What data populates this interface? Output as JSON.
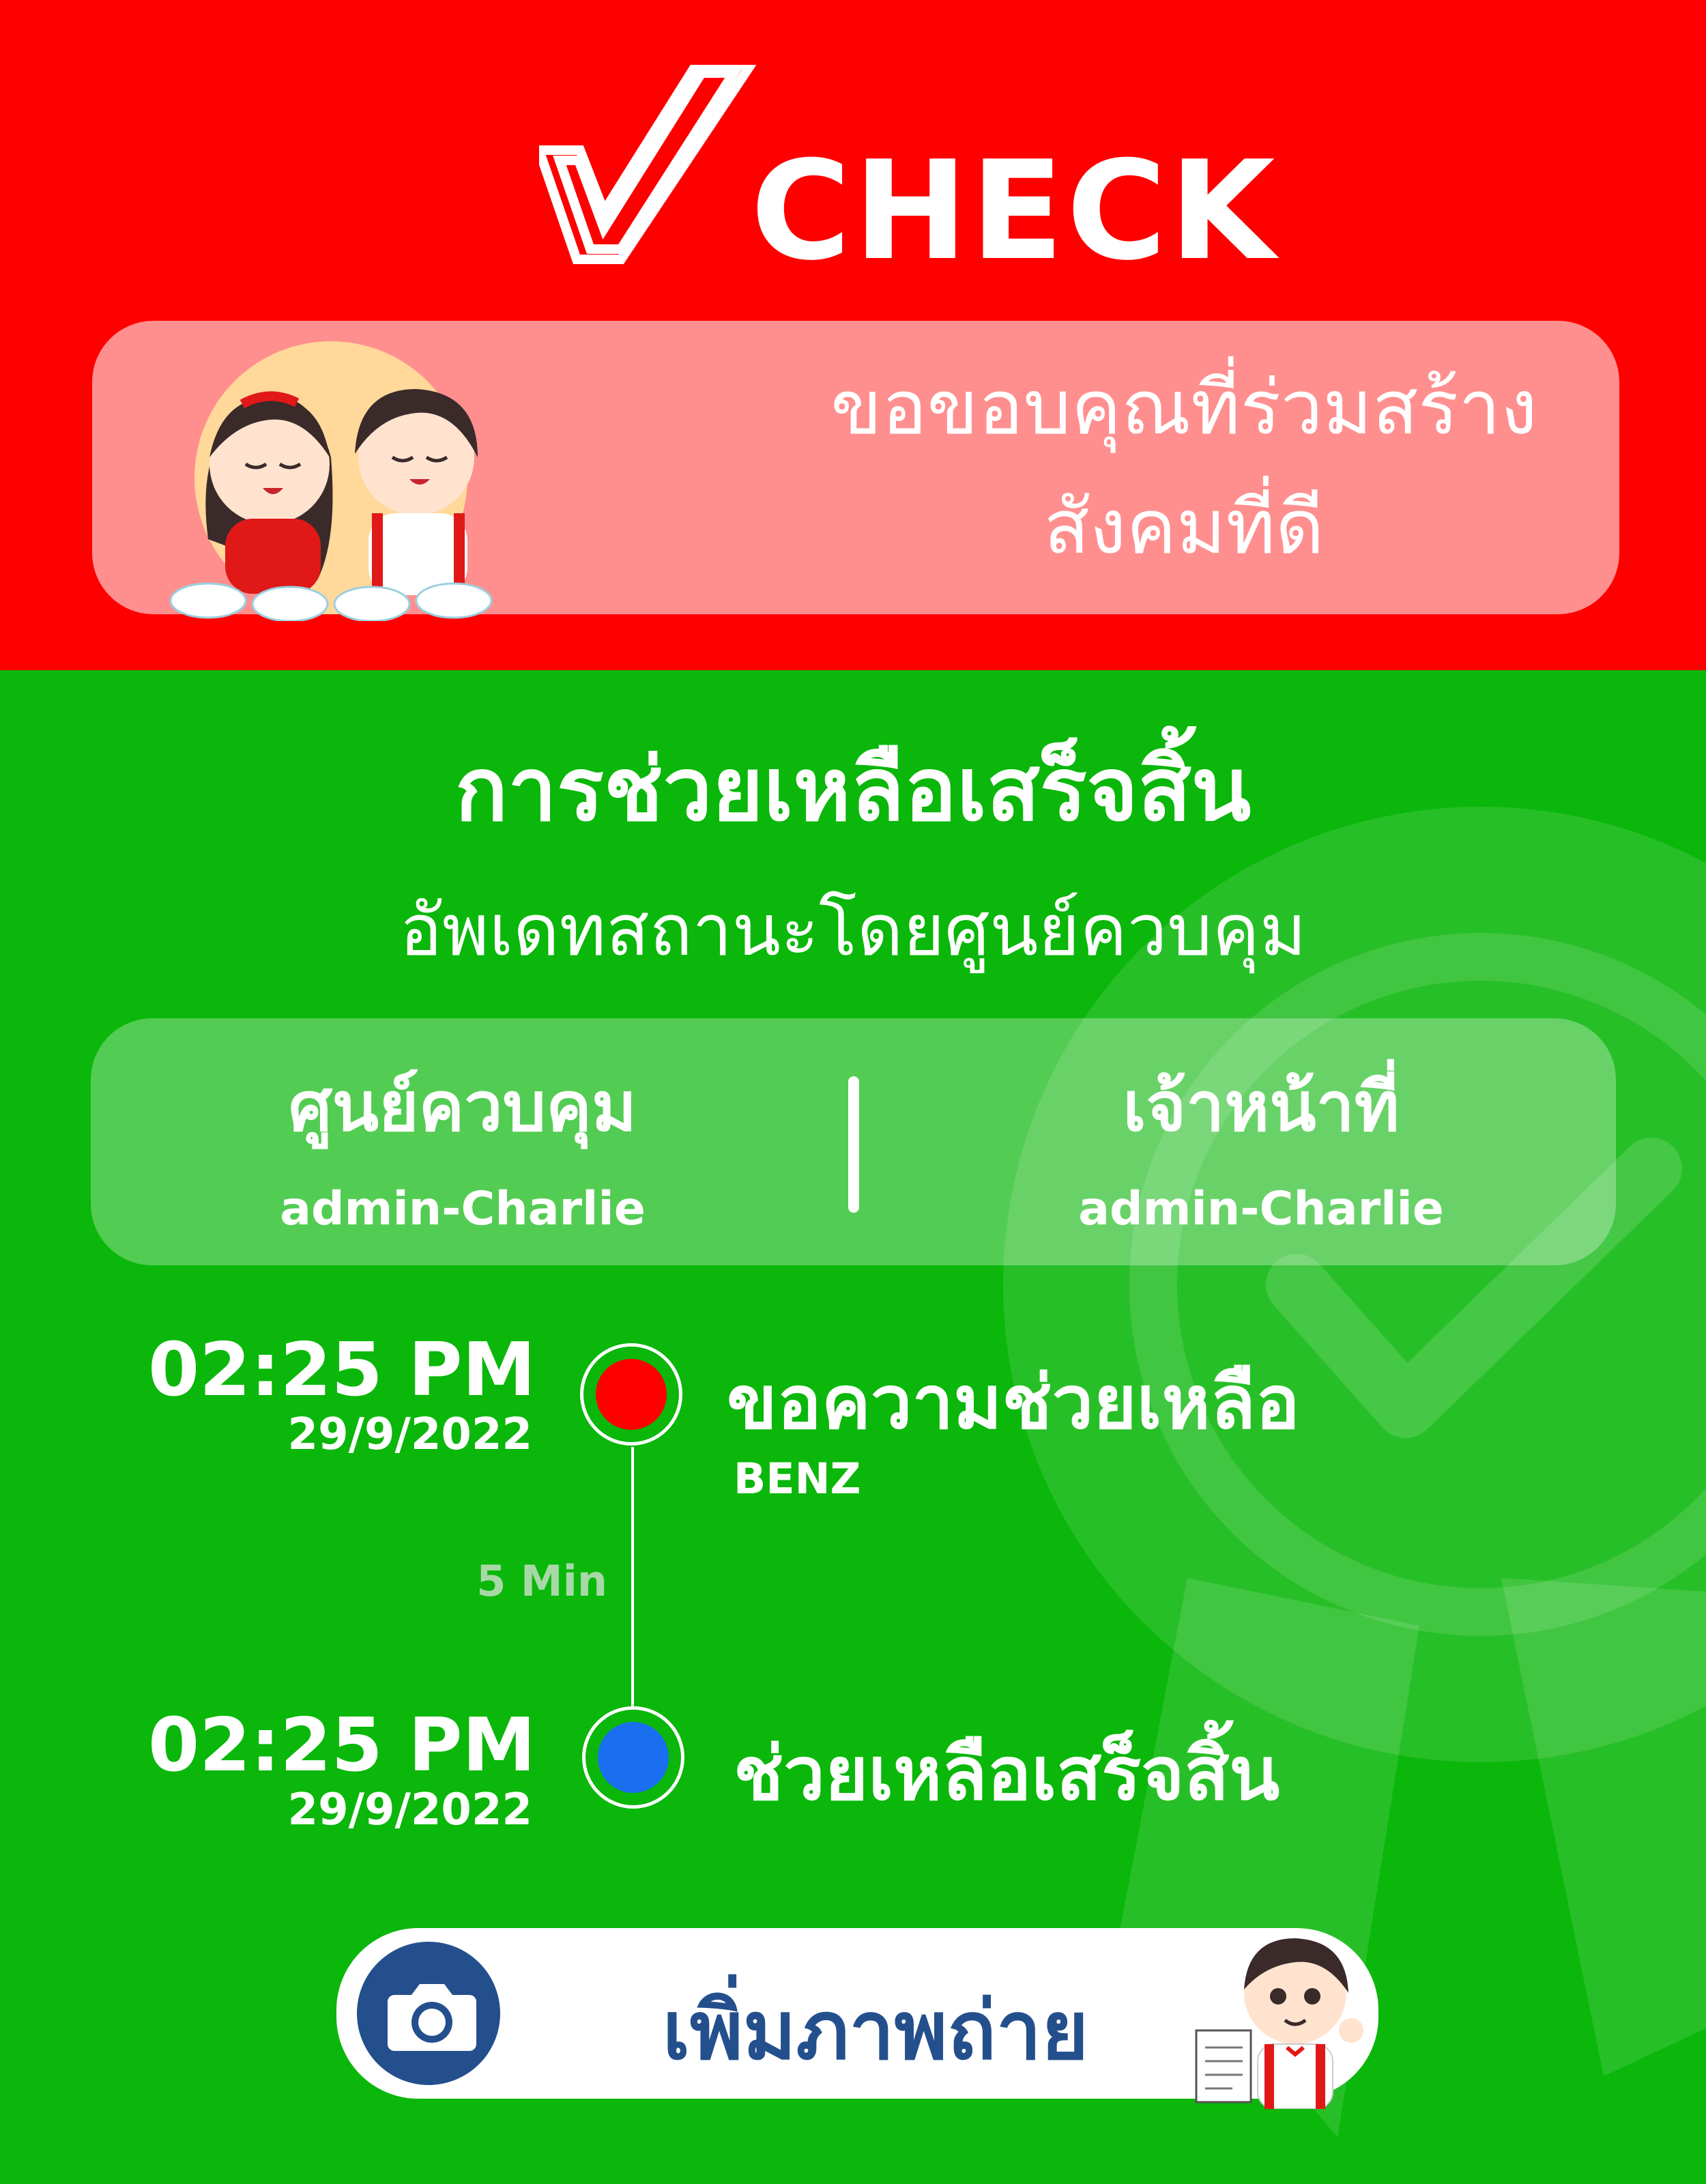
{
  "brand": {
    "logo_text": "CHECK"
  },
  "thanks": {
    "line1": "ขอขอบคุณที่ร่วมสร้าง",
    "line2": "สังคมที่ดี"
  },
  "status": {
    "title": "การช่วยเหลือเสร็จสิ้น",
    "subtitle": "อัพเดทสถานะโดยศูนย์ควบคุม"
  },
  "info": {
    "left_label": "ศูนย์ควบคุม",
    "left_value": "admin-Charlie",
    "right_label": "เจ้าหน้าที่",
    "right_value": "admin-Charlie"
  },
  "timeline": {
    "events": [
      {
        "time": "02:25 PM",
        "date": "29/9/2022",
        "label": "ขอความช่วยเหลือ",
        "sub": "BENZ",
        "dot_color": "#ff0000"
      },
      {
        "time": "02:25 PM",
        "date": "29/9/2022",
        "label": "ช่วยเหลือเสร็จสิ้น",
        "sub": "",
        "dot_color": "#1a6ff0"
      }
    ],
    "duration": "5 Min"
  },
  "action": {
    "add_photo_label": "เพิ่มภาพถ่าย",
    "icon": "camera-icon"
  },
  "colors": {
    "top_bg": "#ff0000",
    "bottom_bg": "#0ab70a",
    "accent_blue": "#244f8d"
  }
}
